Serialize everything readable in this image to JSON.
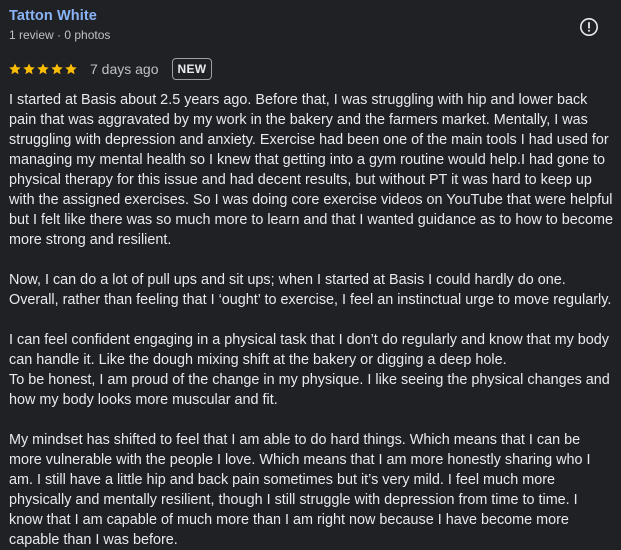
{
  "reviewer": {
    "name": "Tatton White",
    "meta": "1 review · 0 photos"
  },
  "icons": {
    "report": "report-icon",
    "star": "star-icon"
  },
  "colors": {
    "name_link": "#8ab4f8",
    "star": "#fbbc04",
    "text": "#e8eaed",
    "muted": "#bdc1c6",
    "background": "#202124"
  },
  "rating": {
    "stars": 5,
    "max": 5
  },
  "date": "7 days ago",
  "badge": "NEW",
  "review": {
    "paragraphs": [
      "I started at Basis about 2.5 years ago. Before that, I was struggling with hip and lower back pain that was aggravated by my work in the bakery and the farmers market. Mentally, I was struggling with depression and anxiety. Exercise had been one of the main tools I had used for managing my mental health so I knew that getting into a gym routine would help.I had gone to physical therapy for this issue and had decent results, but without PT it was hard to keep up with the assigned exercises. So I was doing core exercise videos on YouTube that were helpful but I felt like there was so much more to learn and that I wanted guidance as to how to become more strong and resilient.",
      "Now, I can do a lot of pull ups and sit ups; when I started at Basis I could hardly do one. Overall, rather than feeling that I ‘ought’ to exercise, I feel an instinctual urge to move regularly.",
      "I can feel confident engaging in a physical task that I don’t do regularly and know that my body can handle it. Like the dough mixing shift at the bakery or digging a deep hole.",
      "To be honest, I am proud of the change in my physique. I like seeing the physical changes and how my body looks more muscular and fit.",
      "My mindset has shifted to feel that I am able to do hard things. Which means that I can be more vulnerable with the people I love. Which means that I am more honestly sharing who I am. I still have a little hip and back pain sometimes but it’s very mild. I feel much more physically and mentally resilient, though I still struggle with depression from time to time. I know that I am capable of much more than I am right now because I have become more capable than I was before."
    ]
  }
}
